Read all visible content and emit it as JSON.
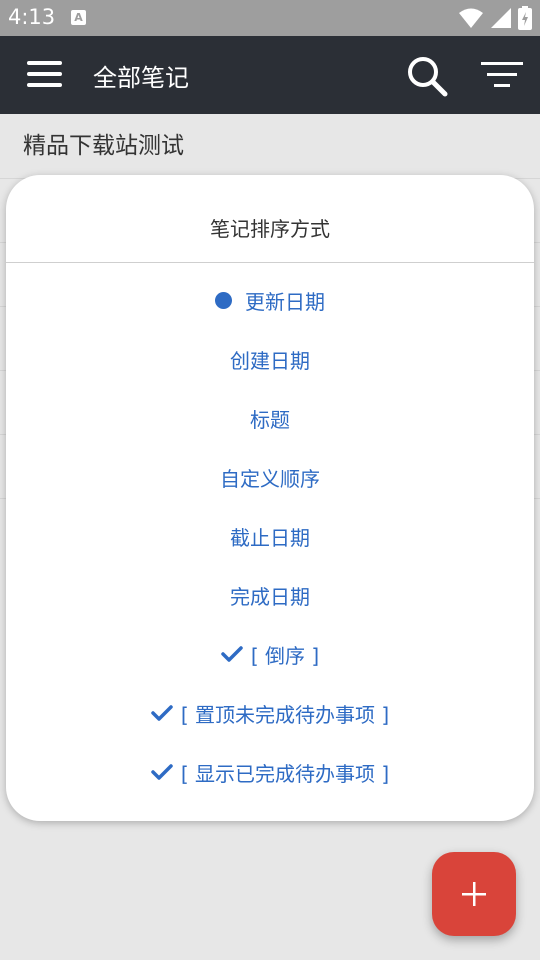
{
  "status_bar": {
    "time": "4:13",
    "notification_badge": "A",
    "icons": [
      "wifi-icon",
      "signal-icon",
      "battery-icon"
    ]
  },
  "app_bar": {
    "title": "全部笔记",
    "icons": [
      "menu-icon",
      "search-icon",
      "filter-icon"
    ]
  },
  "note_list": {
    "items": [
      "精品下载站测试",
      "",
      "",
      "",
      "",
      ""
    ]
  },
  "sort_dialog": {
    "title": "笔记排序方式",
    "options": [
      {
        "label": "更新日期",
        "state": "selected"
      },
      {
        "label": "创建日期",
        "state": "none"
      },
      {
        "label": "标题",
        "state": "none"
      },
      {
        "label": "自定义顺序",
        "state": "none"
      },
      {
        "label": "截止日期",
        "state": "none"
      },
      {
        "label": "完成日期",
        "state": "none"
      }
    ],
    "toggles": [
      {
        "label": "[ 倒序 ]",
        "checked": true
      },
      {
        "label": "[ 置顶未完成待办事项 ]",
        "checked": true
      },
      {
        "label": "[ 显示已完成待办事项 ]",
        "checked": true
      }
    ]
  },
  "fab": {
    "icon": "plus-icon"
  },
  "colors": {
    "app_bar": "#2b2f36",
    "accent": "#2e6bc4",
    "fab": "#d9443a",
    "status_bar": "#9e9e9e"
  }
}
